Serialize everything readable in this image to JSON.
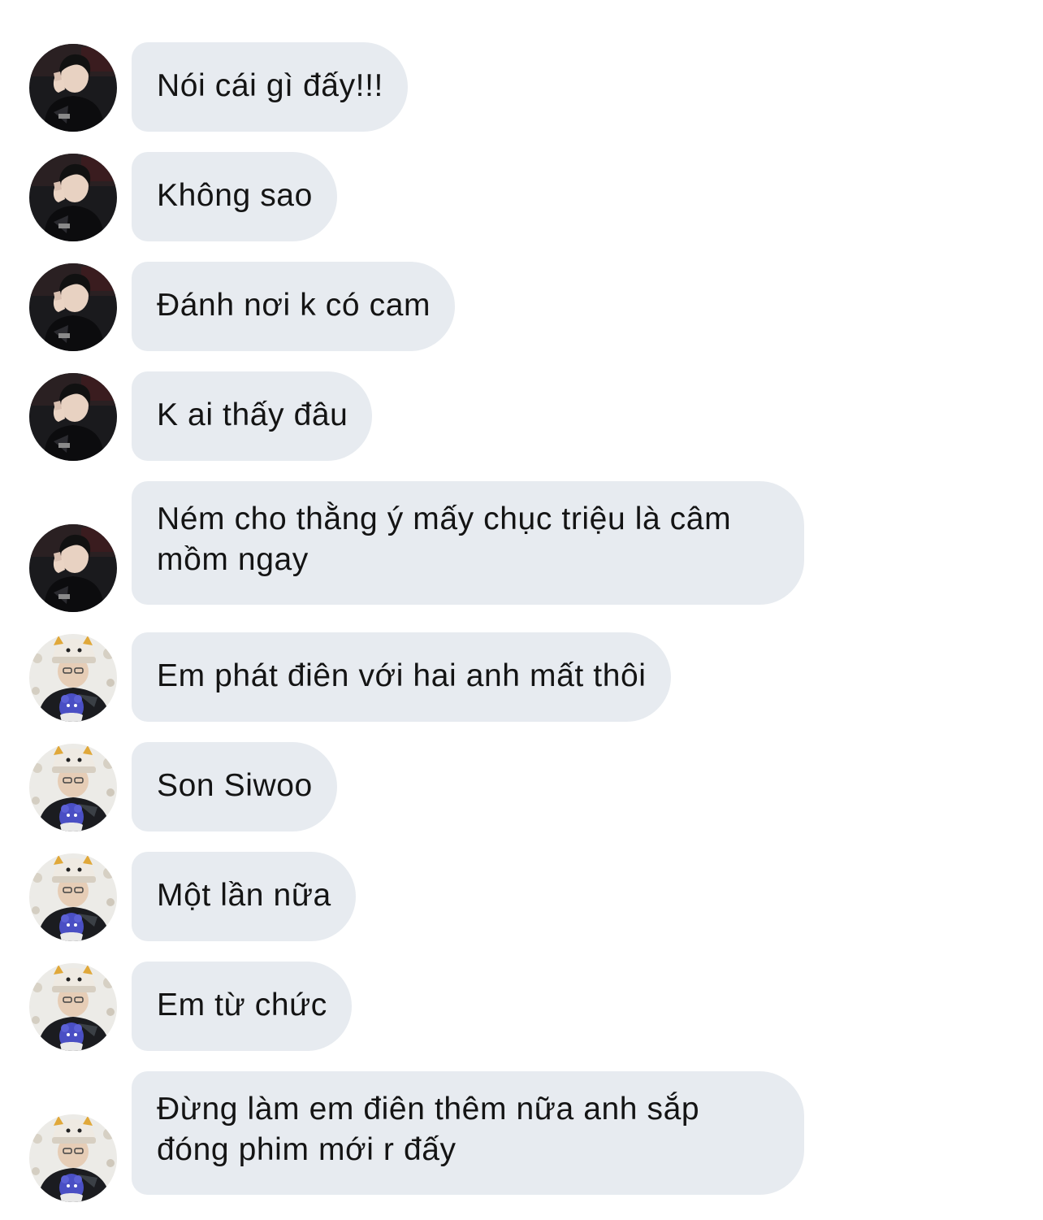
{
  "conversation": {
    "senders": {
      "a": {
        "avatar_icon": "avatar-photo-dark-jacket"
      },
      "b": {
        "avatar_icon": "avatar-photo-cat-hat"
      }
    },
    "messages": [
      {
        "sender": "a",
        "text": "Nói cái gì đấy!!!"
      },
      {
        "sender": "a",
        "text": "Không sao"
      },
      {
        "sender": "a",
        "text": "Đánh nơi k có cam"
      },
      {
        "sender": "a",
        "text": "K ai thấy đâu"
      },
      {
        "sender": "a",
        "text": "Ném cho thằng ý mấy chục triệu là câm mồm ngay"
      },
      {
        "sender": "b",
        "text": "Em phát điên với hai anh mất thôi"
      },
      {
        "sender": "b",
        "text": "Son Siwoo"
      },
      {
        "sender": "b",
        "text": "Một lần nữa"
      },
      {
        "sender": "b",
        "text": "Em từ chức"
      },
      {
        "sender": "b",
        "text": "Đừng làm em điên thêm nữa anh sắp đóng phim mới r đấy"
      }
    ]
  },
  "colors": {
    "bubble_background": "#e7ebf0",
    "text": "#141414",
    "page_background": "#ffffff"
  }
}
